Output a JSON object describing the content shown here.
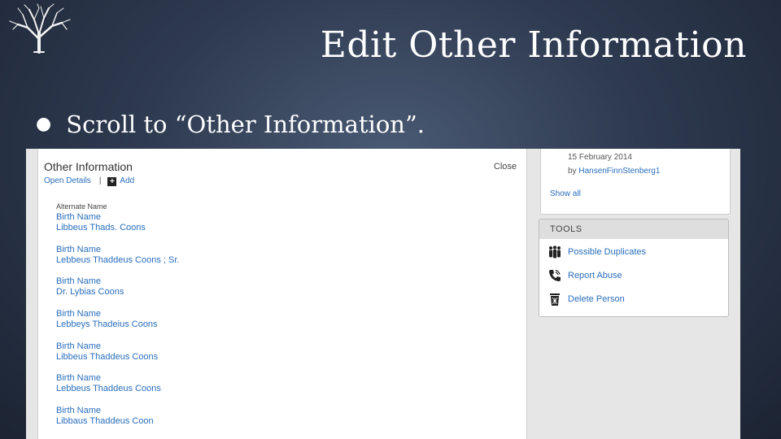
{
  "slide": {
    "title": "Edit Other Information",
    "bullet": "Scroll to “Other Information”."
  },
  "other_info": {
    "title": "Other Information",
    "close_label": "Close",
    "open_details_label": "Open Details",
    "separator": "|",
    "add_label": "Add",
    "section_heading": "Alternate Name",
    "entries": [
      {
        "type": "Birth Name",
        "value": "Libbeus Thads. Coons"
      },
      {
        "type": "Birth Name",
        "value": "Lebbeus Thaddeus Coons ; Sr."
      },
      {
        "type": "Birth Name",
        "value": "Dr. Lybias Coons"
      },
      {
        "type": "Birth Name",
        "value": "Lebbeys Thadeius Coons"
      },
      {
        "type": "Birth Name",
        "value": "Libbeus Thaddeus Coons"
      },
      {
        "type": "Birth Name",
        "value": "Lebbeus Thaddeus Coons"
      },
      {
        "type": "Birth Name",
        "value": "Libbaus Thaddeus Coon"
      }
    ]
  },
  "history": {
    "date": "15 February 2014",
    "by_prefix": "by",
    "user": "HansenFinnStenberg1",
    "show_all_label": "Show all"
  },
  "tools": {
    "header": "TOOLS",
    "items": [
      {
        "label": "Possible Duplicates",
        "icon": "people-icon"
      },
      {
        "label": "Report Abuse",
        "icon": "phone-icon"
      },
      {
        "label": "Delete Person",
        "icon": "trash-icon"
      }
    ]
  }
}
